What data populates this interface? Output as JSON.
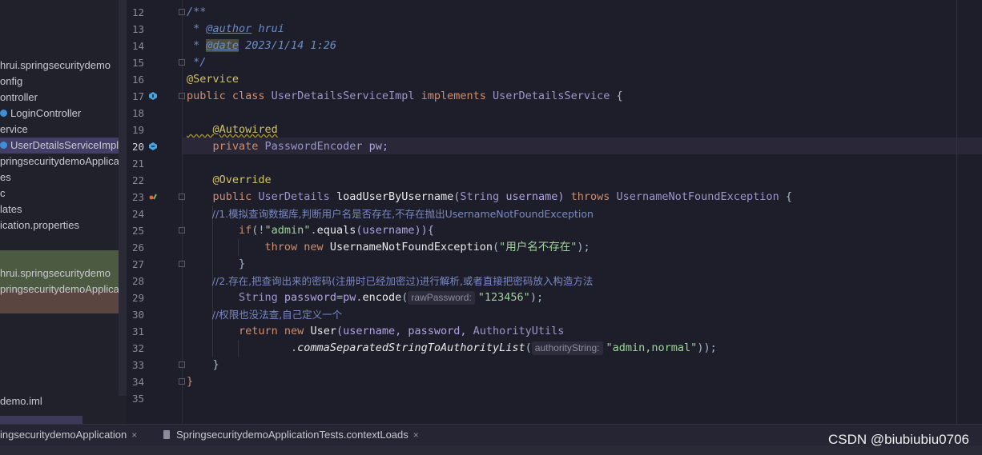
{
  "project_tree": {
    "items": [
      {
        "label": "hrui.springsecuritydemo"
      },
      {
        "label": "onfig"
      },
      {
        "label": "ontroller"
      },
      {
        "label": "LoginController"
      },
      {
        "label": "ervice"
      },
      {
        "label": "UserDetailsServiceImpl"
      },
      {
        "label": "pringsecuritydemoApplica"
      },
      {
        "label": "es"
      },
      {
        "label": "c"
      },
      {
        "label": "lates"
      },
      {
        "label": "ication.properties"
      },
      {
        "label": "hrui.springsecuritydemo"
      },
      {
        "label": "pringsecuritydemoApplica"
      },
      {
        "label": "demo.iml"
      }
    ]
  },
  "editor": {
    "line_numbers": [
      "12",
      "13",
      "14",
      "15",
      "16",
      "17",
      "18",
      "19",
      "20",
      "21",
      "22",
      "23",
      "24",
      "25",
      "26",
      "27",
      "28",
      "29",
      "30",
      "31",
      "32",
      "33",
      "34",
      "35"
    ],
    "current_line": "20",
    "lines": {
      "l12": "/**",
      "l13_star": " * ",
      "l13_tag": "@author",
      "l13_val": " hrui",
      "l14_star": " * ",
      "l14_tag": "@date",
      "l14_val": " 2023/1/14 1:26",
      "l15": " */",
      "l16": "@Service",
      "l17_a": "public class ",
      "l17_b": "UserDetailsServiceImpl",
      "l17_c": " implements ",
      "l17_d": "UserDetailsService",
      "l17_e": " {",
      "l19": "    @Autowired",
      "l20_a": "    private ",
      "l20_b": "PasswordEncoder",
      "l20_c": " pw;",
      "l22": "    @Override",
      "l23_a": "    public ",
      "l23_b": "UserDetails ",
      "l23_c": "loadUserByUsername",
      "l23_d": "(",
      "l23_e": "String",
      "l23_f": " username) ",
      "l23_g": "throws ",
      "l23_h": "UsernameNotFoundException",
      "l23_i": " {",
      "l24": "        //1.模拟查询数据库,判断用户名是否存在,不存在抛出UsernameNotFoundException",
      "l25_a": "        if",
      "l25_b": "(!",
      "l25_c": "\"admin\"",
      "l25_d": ".",
      "l25_e": "equals",
      "l25_f": "(username)){",
      "l26_a": "            throw new ",
      "l26_b": "UsernameNotFoundException",
      "l26_c": "(",
      "l26_d": "\"用户名不存在\"",
      "l26_e": ");",
      "l27": "        }",
      "l28": "        //2.存在,把查询出来的密码(注册时已经加密过)进行解析,或者直接把密码放入构造方法",
      "l29_a": "        String ",
      "l29_b": "password",
      "l29_c": "=",
      "l29_d": "pw",
      "l29_e": ".",
      "l29_f": "encode",
      "l29_g": "(",
      "l29_hint": "rawPassword:",
      "l29_h": "\"123456\"",
      "l29_i": ");",
      "l30": "        //权限也没法查,自己定义一个",
      "l31_a": "        return new ",
      "l31_b": "User",
      "l31_c": "(username, password, ",
      "l31_d": "AuthorityUtils",
      "l32_a": "                .",
      "l32_b": "commaSeparatedStringToAuthorityList",
      "l32_c": "(",
      "l32_hint": "authorityString:",
      "l32_d": "\"admin,normal\"",
      "l32_e": "));",
      "l33": "    }",
      "l34": "}"
    }
  },
  "tabs": [
    {
      "label": "ingsecuritydemoApplication",
      "close": "×"
    },
    {
      "label": "SpringsecuritydemoApplicationTests.contextLoads",
      "close": "×"
    }
  ],
  "watermark": "CSDN @biubiubiu0706",
  "colors": {
    "background": "#1e1e2b",
    "keyword": "#cf8e6d",
    "string": "#9fd39a",
    "annotation": "#d0c26c",
    "comment": "#7a88c4"
  }
}
